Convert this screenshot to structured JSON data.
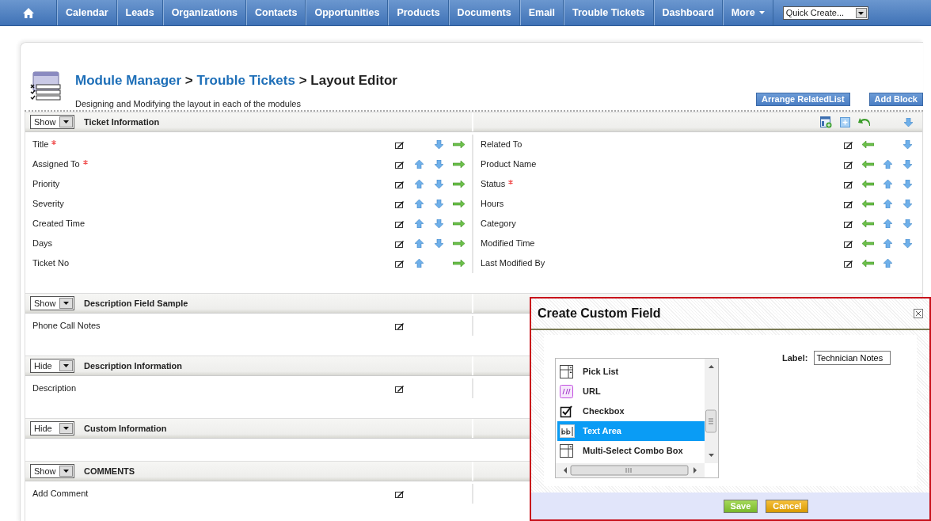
{
  "nav": {
    "items": [
      {
        "label": "Calendar",
        "kind": "link"
      },
      {
        "label": "Leads",
        "kind": "link"
      },
      {
        "label": "Organizations",
        "kind": "link"
      },
      {
        "label": "Contacts",
        "kind": "link"
      },
      {
        "label": "Opportunities",
        "kind": "link"
      },
      {
        "label": "Products",
        "kind": "link"
      },
      {
        "label": "Documents",
        "kind": "link"
      },
      {
        "label": "Email",
        "kind": "link"
      },
      {
        "label": "Trouble Tickets",
        "kind": "link"
      },
      {
        "label": "Dashboard",
        "kind": "link"
      },
      {
        "label": "More",
        "kind": "menu"
      }
    ],
    "quick_create": "Quick Create..."
  },
  "breadcrumb": [
    {
      "label": "Module Manager",
      "link": true
    },
    {
      "label": ">",
      "link": false
    },
    {
      "label": "Trouble Tickets",
      "link": true
    },
    {
      "label": "> Layout Editor",
      "link": false
    }
  ],
  "subtitle": "Designing and Modifying the layout in each of the modules",
  "buttons": [
    "Arrange RelatedList",
    "Add Block"
  ],
  "blocks": [
    {
      "visibility": "Show",
      "title": "Ticket Information",
      "tools": true,
      "left": [
        {
          "name": "Title",
          "required": true,
          "up": false,
          "down": true,
          "switch": true
        },
        {
          "name": "Assigned To",
          "required": true,
          "up": true,
          "down": true,
          "switch": true
        },
        {
          "name": "Priority",
          "required": false,
          "up": true,
          "down": true,
          "switch": true
        },
        {
          "name": "Severity",
          "required": false,
          "up": true,
          "down": true,
          "switch": true
        },
        {
          "name": "Created Time",
          "required": false,
          "up": true,
          "down": true,
          "switch": true
        },
        {
          "name": "Days",
          "required": false,
          "up": true,
          "down": true,
          "switch": true
        },
        {
          "name": "Ticket No",
          "required": false,
          "up": true,
          "down": false,
          "switch": true
        }
      ],
      "right": [
        {
          "name": "Related To",
          "required": false,
          "up": false,
          "down": true,
          "switch": true
        },
        {
          "name": "Product Name",
          "required": false,
          "up": true,
          "down": true,
          "switch": true
        },
        {
          "name": "Status",
          "required": true,
          "up": true,
          "down": true,
          "switch": true
        },
        {
          "name": "Hours",
          "required": false,
          "up": true,
          "down": true,
          "switch": true
        },
        {
          "name": "Category",
          "required": false,
          "up": true,
          "down": true,
          "switch": true
        },
        {
          "name": "Modified Time",
          "required": false,
          "up": true,
          "down": true,
          "switch": true
        },
        {
          "name": "Last Modified By",
          "required": false,
          "up": true,
          "down": false,
          "switch": true
        }
      ]
    },
    {
      "visibility": "Show",
      "title": "Description Field Sample",
      "left": [
        {
          "name": "Phone Call Notes",
          "required": false,
          "up": false,
          "down": false,
          "switch": false
        }
      ]
    },
    {
      "visibility": "Hide",
      "title": "Description Information",
      "left": [
        {
          "name": "Description",
          "required": false,
          "up": false,
          "down": false,
          "switch": false
        }
      ]
    },
    {
      "visibility": "Hide",
      "title": "Custom Information"
    },
    {
      "visibility": "Show",
      "title": "COMMENTS",
      "left": [
        {
          "name": "Add Comment",
          "required": false,
          "up": false,
          "down": false,
          "switch": false
        }
      ]
    }
  ],
  "dialog": {
    "title": "Create Custom Field",
    "types": [
      {
        "label": "Pick List",
        "kind": "picklist",
        "selected": false
      },
      {
        "label": "URL",
        "kind": "url",
        "selected": false
      },
      {
        "label": "Checkbox",
        "kind": "checkbox",
        "selected": false
      },
      {
        "label": "Text Area",
        "kind": "textarea",
        "selected": true
      },
      {
        "label": "Multi-Select Combo Box",
        "kind": "multiselect",
        "selected": false
      }
    ],
    "label_caption": "Label:",
    "label_value": "Technician Notes",
    "buttons": [
      {
        "label": "Save",
        "kind": "save"
      },
      {
        "label": "Cancel",
        "kind": "cancel"
      }
    ]
  }
}
